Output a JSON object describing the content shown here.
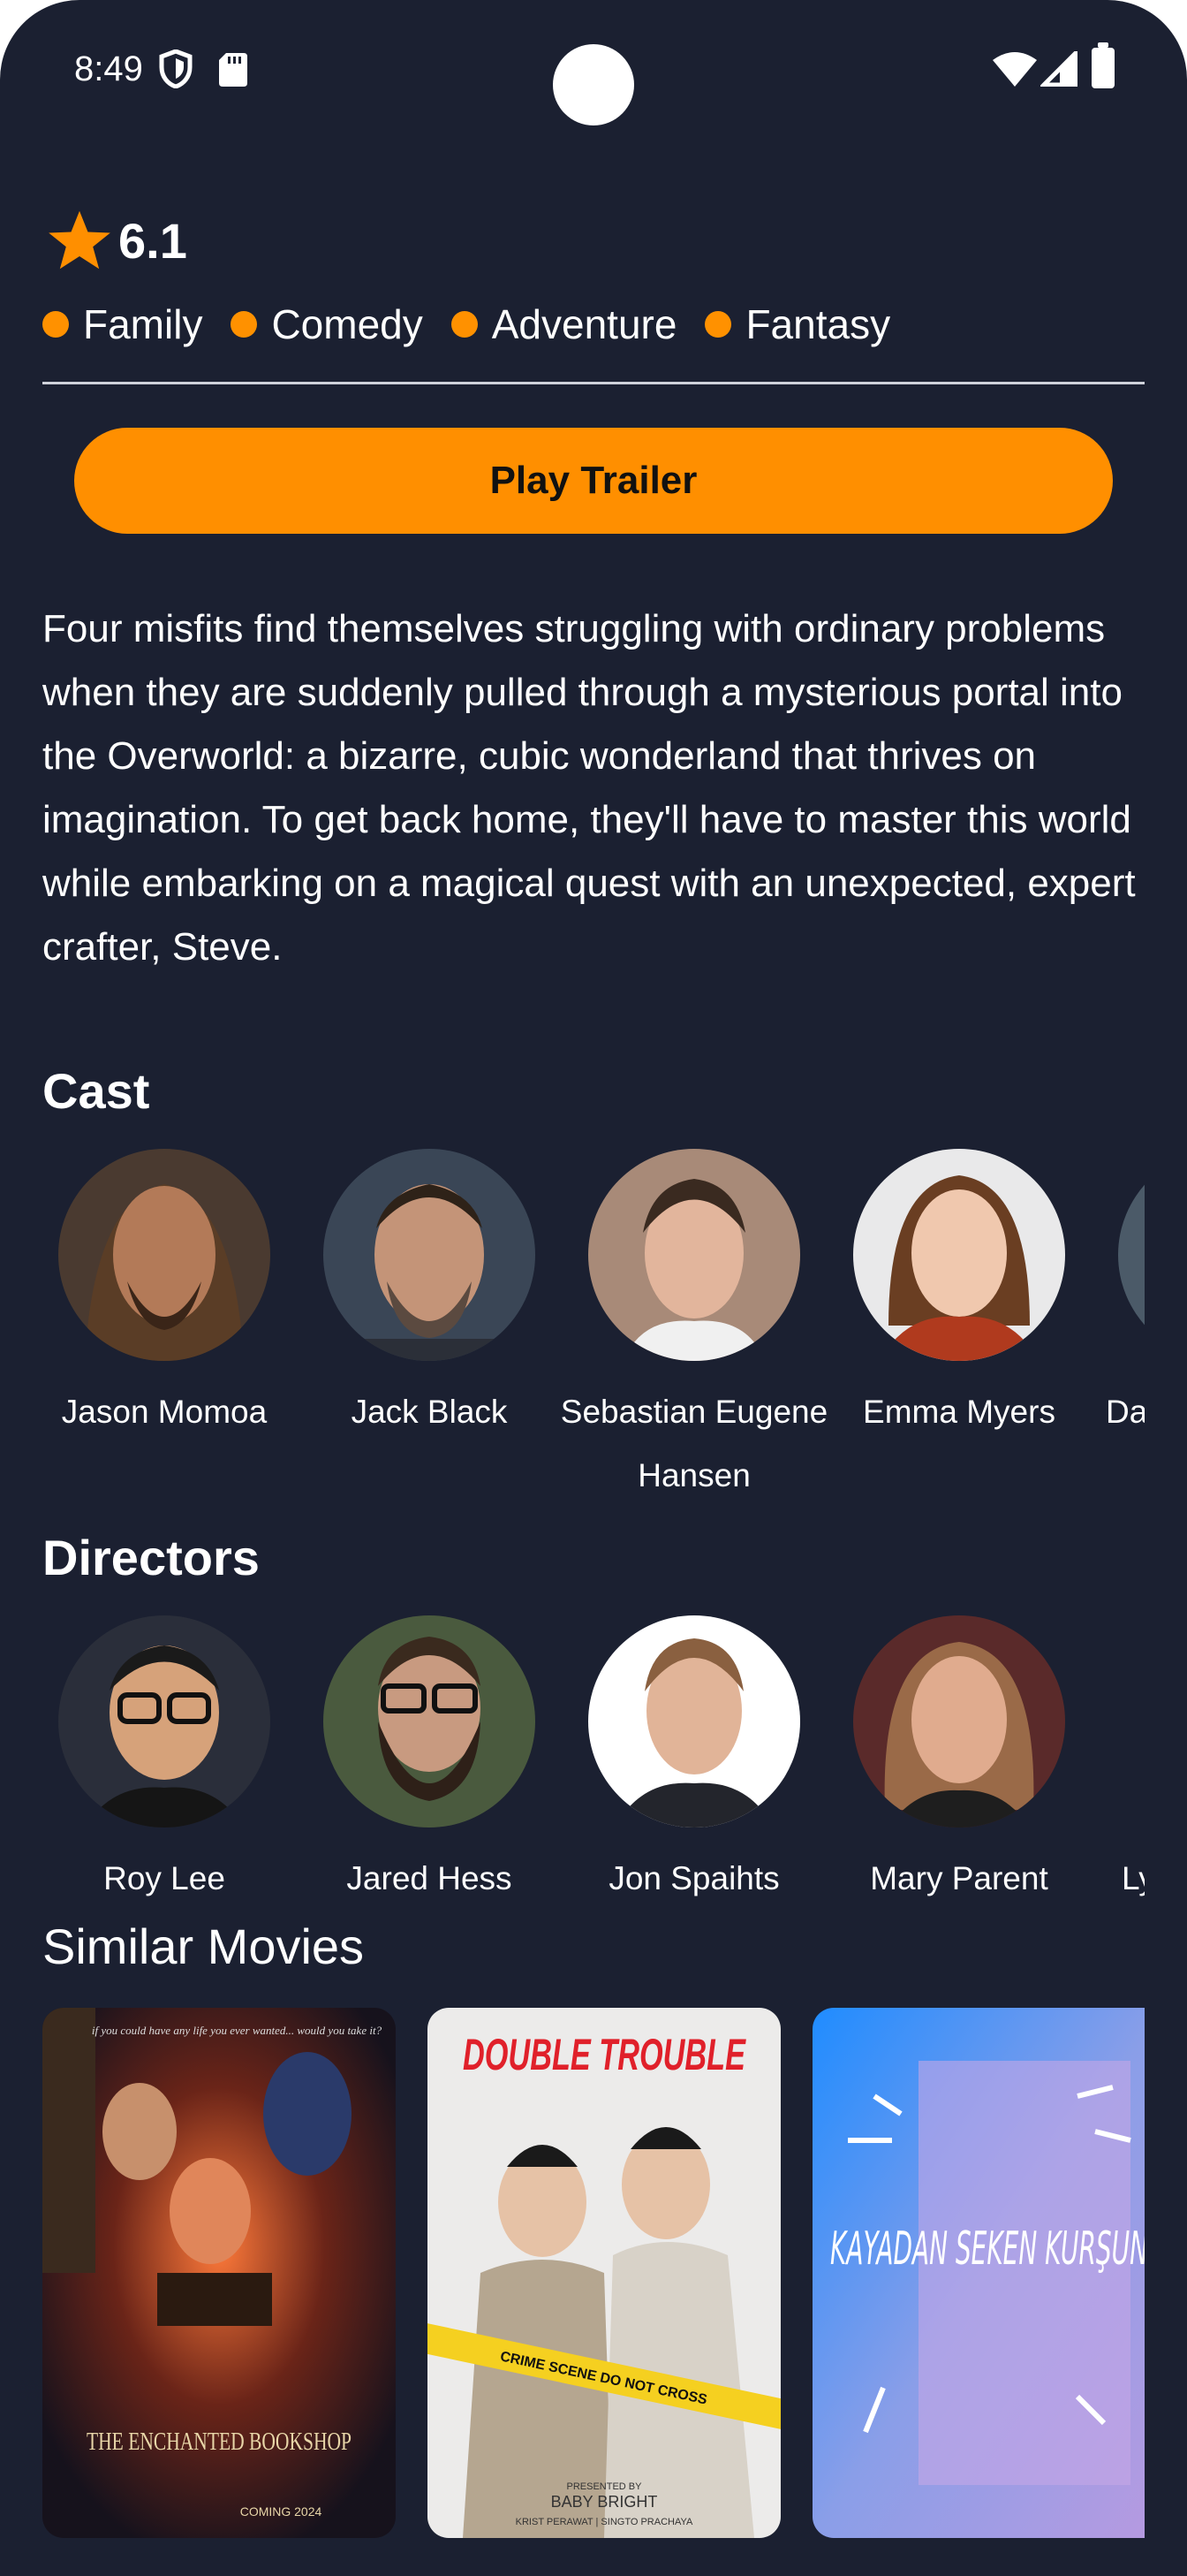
{
  "status_bar": {
    "time": "8:49"
  },
  "rating": {
    "value": "6.1",
    "icon": "star-icon",
    "color": "#ff8f00"
  },
  "genres": [
    "Family",
    "Comedy",
    "Adventure",
    "Fantasy"
  ],
  "play_trailer_label": "Play Trailer",
  "overview": "Four misfits find themselves struggling with ordinary problems when they are suddenly pulled through a mysterious portal into the Overworld: a bizarre, cubic wonderland that thrives on imagination. To get back home, they'll have to master this world while embarking on a magical quest with an unexpected, expert crafter, Steve.",
  "cast": {
    "title": "Cast",
    "people": [
      {
        "name": "Jason Momoa"
      },
      {
        "name": "Jack Black"
      },
      {
        "name": "Sebastian Eugene Hansen"
      },
      {
        "name": "Emma Myers"
      },
      {
        "name": "Da"
      }
    ]
  },
  "directors": {
    "title": "Directors",
    "people": [
      {
        "name": "Roy Lee"
      },
      {
        "name": "Jared Hess"
      },
      {
        "name": "Jon Spaihts"
      },
      {
        "name": "Mary Parent"
      },
      {
        "name": "Ly"
      }
    ]
  },
  "similar_movies": {
    "title": "Similar Movies",
    "movies": [
      {
        "poster_text": [
          "if you could have any life you ever wanted... would you take it?",
          "THE ENCHANTED BOOKSHOP",
          "COMING 2024"
        ]
      },
      {
        "poster_text": [
          "DOUBLE TROUBLE",
          "CRIME SCENE DO NOT CROSS",
          "PRESENTED BY",
          "BABY BRIGHT",
          "KRIST PERAWAT | SINGTO PRACHAYA"
        ]
      },
      {
        "poster_text": [
          "KAYADAN SEKEN KURŞUN"
        ]
      }
    ]
  },
  "colors": {
    "background": "#1b2031",
    "accent": "#ff8f00"
  }
}
